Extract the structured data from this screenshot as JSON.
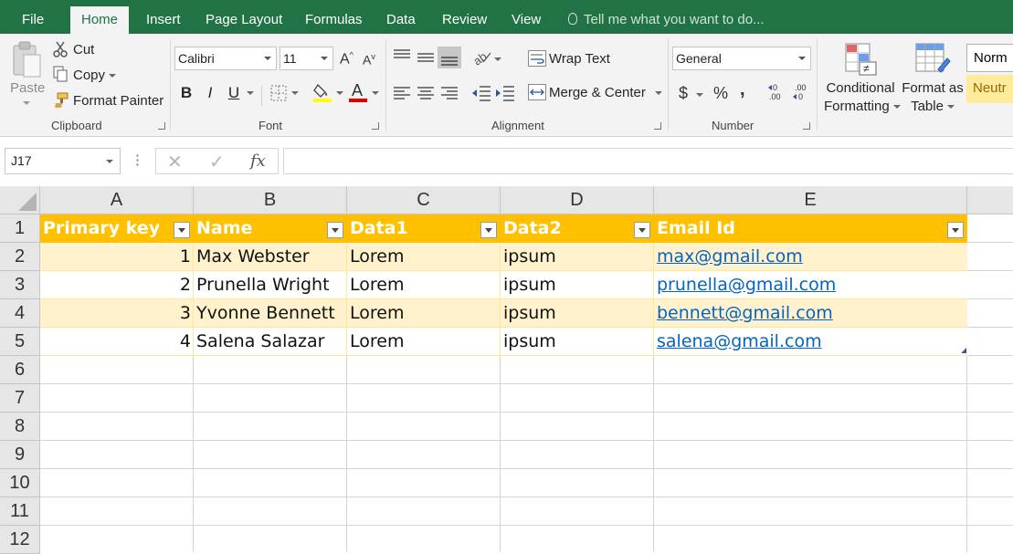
{
  "tabs": [
    {
      "label": "File",
      "active": false
    },
    {
      "label": "Home",
      "active": true
    },
    {
      "label": "Insert",
      "active": false
    },
    {
      "label": "Page Layout",
      "active": false
    },
    {
      "label": "Formulas",
      "active": false
    },
    {
      "label": "Data",
      "active": false
    },
    {
      "label": "Review",
      "active": false
    },
    {
      "label": "View",
      "active": false
    }
  ],
  "tell_me": "Tell me what you want to do...",
  "clipboard": {
    "paste": "Paste",
    "cut": "Cut",
    "copy": "Copy",
    "format_painter": "Format Painter",
    "group_label": "Clipboard"
  },
  "font": {
    "name": "Calibri",
    "size": "11",
    "group_label": "Font",
    "bold": "B",
    "italic": "I",
    "underline": "U"
  },
  "alignment": {
    "wrap_text": "Wrap Text",
    "merge_center": "Merge & Center",
    "group_label": "Alignment"
  },
  "number": {
    "format": "General",
    "currency": "$",
    "percent": "%",
    "comma": ",",
    "group_label": "Number"
  },
  "styles": {
    "conditional_formatting_line1": "Conditional",
    "conditional_formatting_line2": "Formatting",
    "format_as_table_line1": "Format as",
    "format_as_table_line2": "Table",
    "style_normal": "Norm",
    "style_neutral": "Neutr"
  },
  "name_box": "J17",
  "fx_label": "fx",
  "columns": [
    "A",
    "B",
    "C",
    "D",
    "E"
  ],
  "rows": [
    "1",
    "2",
    "3",
    "4",
    "5",
    "6",
    "7",
    "8",
    "9",
    "10",
    "11",
    "12"
  ],
  "table": {
    "headers": [
      "Primary key",
      "Name",
      "Data1",
      "Data2",
      "Email Id"
    ],
    "rows": [
      [
        "1",
        "Max Webster",
        "Lorem",
        "ipsum",
        "max@gmail.com"
      ],
      [
        "2",
        "Prunella Wright",
        "Lorem",
        "ipsum",
        "prunella@gmail.com"
      ],
      [
        "3",
        "Yvonne Bennett",
        "Lorem",
        "ipsum",
        "bennett@gmail.com"
      ],
      [
        "4",
        "Salena Salazar",
        "Lorem",
        "ipsum",
        "salena@gmail.com"
      ]
    ]
  },
  "colors": {
    "ribbon_green": "#217346",
    "table_header": "#ffc000",
    "table_band": "#fff2cc",
    "link": "#0563c1"
  }
}
